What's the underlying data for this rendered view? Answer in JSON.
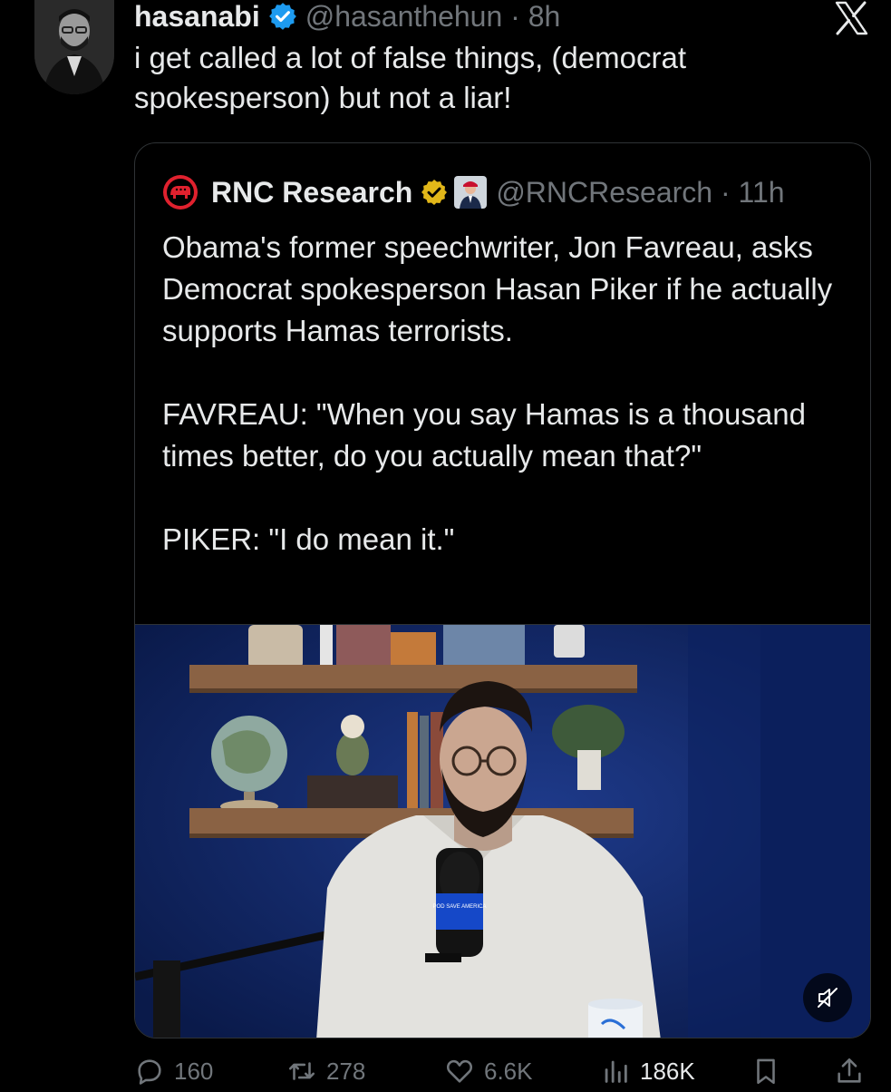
{
  "tweet": {
    "author_name": "hasanabi",
    "handle_time": "@hasanthehun · 8h",
    "text": "i get called a lot of false things, (democrat spokesperson) but not a liar!"
  },
  "quoted": {
    "author_name": "RNC Research",
    "handle_time": "@RNCResearch · 11h",
    "paragraphs": [
      "Obama's former speechwriter, Jon Favreau, asks Democrat spokesperson Hasan Piker if he actually supports Hamas terrorists.",
      "FAVREAU: \"When you say Hamas is a thousand times better, do you actually mean that?\"",
      "PIKER: \"I do mean it.\""
    ],
    "video_mic_label": "POD SAVE AMERICA"
  },
  "actions": {
    "replies": "160",
    "reposts": "278",
    "likes": "6.6K",
    "views": "186K"
  },
  "icons": {
    "verified": "verified-badge-icon",
    "close": "x-logo-icon",
    "gop": "gop-elephant-icon",
    "mute": "muted-speaker-icon",
    "reply": "reply-icon",
    "repost": "repost-icon",
    "like": "heart-icon",
    "views": "views-chart-icon",
    "bookmark": "bookmark-icon",
    "share": "share-icon"
  },
  "colors": {
    "background": "#000000",
    "text": "#e7e9ea",
    "secondary": "#71767b",
    "border": "#2f3336",
    "verified_blue": "#1d9bf0",
    "verified_gold": "#e2b719",
    "gop_red": "#e0212e"
  }
}
